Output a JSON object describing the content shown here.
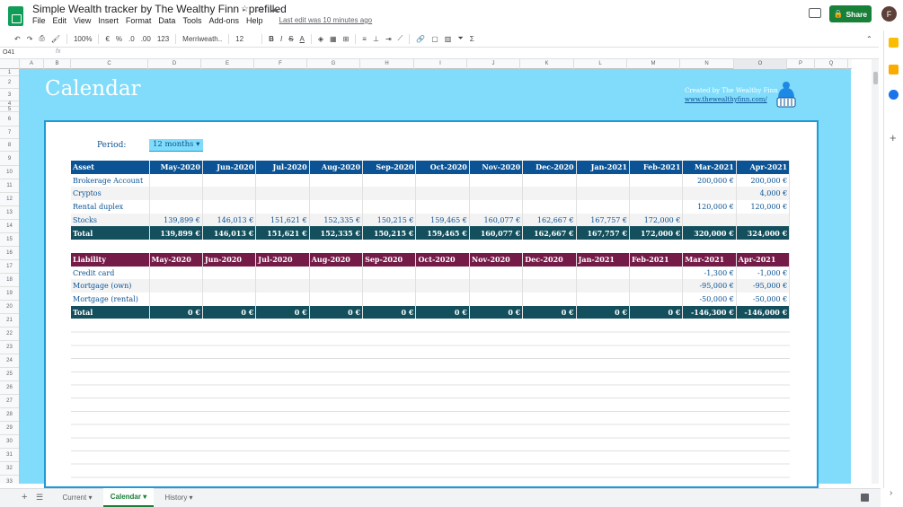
{
  "doc": {
    "title": "Simple Wealth tracker by The Wealthy Finn - prefilled",
    "last_edit": "Last edit was 10 minutes ago",
    "share": "Share",
    "avatar": "F"
  },
  "menu": [
    "File",
    "Edit",
    "View",
    "Insert",
    "Format",
    "Data",
    "Tools",
    "Add-ons",
    "Help"
  ],
  "toolbar": {
    "zoom": "100%",
    "currency": "€",
    "percent": "%",
    "dec_less": ".0",
    "dec_more": ".00",
    "format": "123",
    "font": "Merriweath...",
    "size": "12"
  },
  "formula_bar": {
    "cell": "O41",
    "fx": "fx"
  },
  "columns": [
    "A",
    "B",
    "C",
    "D",
    "E",
    "F",
    "G",
    "H",
    "I",
    "J",
    "K",
    "L",
    "M",
    "N",
    "O",
    "P",
    "Q"
  ],
  "rows": [
    "1",
    "2",
    "3",
    "4",
    "5",
    "6",
    "7",
    "8",
    "9",
    "10",
    "11",
    "12",
    "13",
    "14",
    "15",
    "16",
    "17",
    "18",
    "19",
    "20",
    "21",
    "22",
    "23",
    "24",
    "25",
    "26",
    "27",
    "28",
    "29",
    "30",
    "31",
    "32",
    "33"
  ],
  "sheet": {
    "title": "Calendar",
    "credit": "Created by The Wealthy Finn",
    "link": "www.thewealthyfinn.com/",
    "period_label": "Period:",
    "period_value": "12 months"
  },
  "assets": {
    "headers": [
      "Asset",
      "May-2020",
      "Jun-2020",
      "Jul-2020",
      "Aug-2020",
      "Sep-2020",
      "Oct-2020",
      "Nov-2020",
      "Dec-2020",
      "Jan-2021",
      "Feb-2021",
      "Mar-2021",
      "Apr-2021"
    ],
    "rows": [
      [
        "Brokerage Account",
        "",
        "",
        "",
        "",
        "",
        "",
        "",
        "",
        "",
        "",
        "200,000 €",
        "200,000 €"
      ],
      [
        "Cryptos",
        "",
        "",
        "",
        "",
        "",
        "",
        "",
        "",
        "",
        "",
        "",
        "4,000 €"
      ],
      [
        "Rental duplex",
        "",
        "",
        "",
        "",
        "",
        "",
        "",
        "",
        "",
        "",
        "120,000 €",
        "120,000 €"
      ],
      [
        "Stocks",
        "139,899 €",
        "146,013 €",
        "151,621 €",
        "152,335 €",
        "150,215 €",
        "159,465 €",
        "160,077 €",
        "162,667 €",
        "167,757 €",
        "172,000 €",
        "",
        ""
      ]
    ],
    "total": [
      "Total",
      "139,899 €",
      "146,013 €",
      "151,621 €",
      "152,335 €",
      "150,215 €",
      "159,465 €",
      "160,077 €",
      "162,667 €",
      "167,757 €",
      "172,000 €",
      "320,000 €",
      "324,000 €"
    ]
  },
  "liabilities": {
    "headers": [
      "Liability",
      "May-2020",
      "Jun-2020",
      "Jul-2020",
      "Aug-2020",
      "Sep-2020",
      "Oct-2020",
      "Nov-2020",
      "Dec-2020",
      "Jan-2021",
      "Feb-2021",
      "Mar-2021",
      "Apr-2021"
    ],
    "rows": [
      [
        "Credit card",
        "",
        "",
        "",
        "",
        "",
        "",
        "",
        "",
        "",
        "",
        "-1,300 €",
        "-1,000 €"
      ],
      [
        "Mortgage (own)",
        "",
        "",
        "",
        "",
        "",
        "",
        "",
        "",
        "",
        "",
        "-95,000 €",
        "-95,000 €"
      ],
      [
        "Mortgage (rental)",
        "",
        "",
        "",
        "",
        "",
        "",
        "",
        "",
        "",
        "",
        "-50,000 €",
        "-50,000 €"
      ]
    ],
    "total": [
      "Total",
      "0 €",
      "0 €",
      "0 €",
      "0 €",
      "0 €",
      "0 €",
      "0 €",
      "0 €",
      "0 €",
      "0 €",
      "-146,300 €",
      "-146,000 €"
    ]
  },
  "tabs": [
    "Current",
    "Calendar",
    "History"
  ],
  "colors": {
    "banner": "#80dcfa",
    "asset_header": "#0b5394",
    "liability_header": "#741b47",
    "total": "#134f5c",
    "share": "#188038"
  }
}
